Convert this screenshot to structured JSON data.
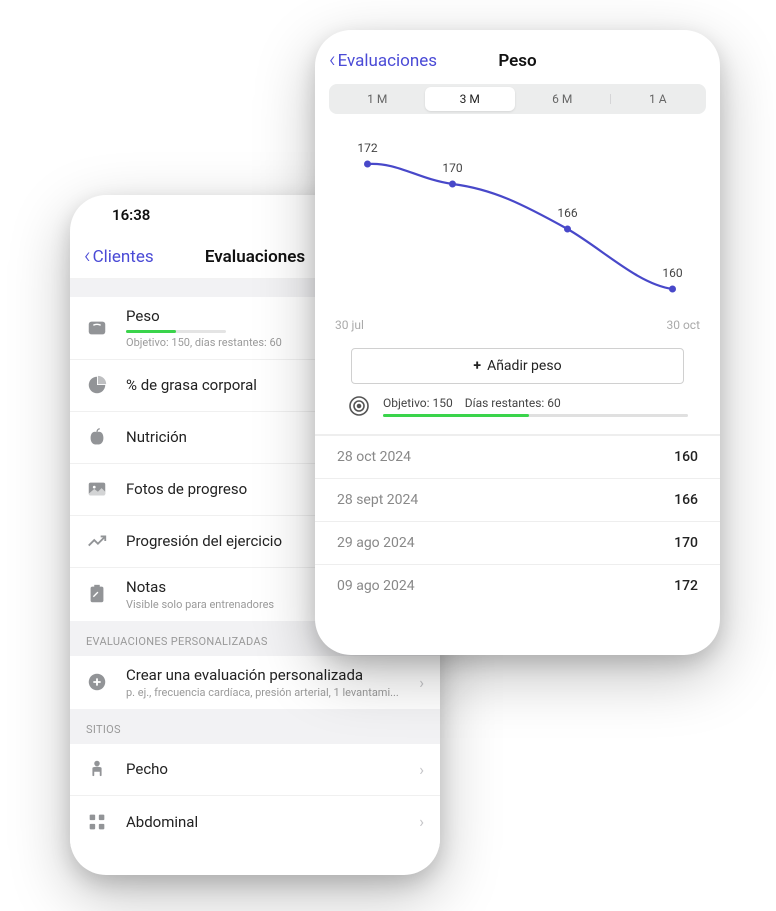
{
  "back_phone": {
    "time": "16:38",
    "back_label": "Clientes",
    "title": "Evaluaciones",
    "assessments": [
      {
        "label": "Peso",
        "subtitle": "Objetivo: 150, días restantes: 60",
        "progress_pct": 50
      },
      {
        "label": "% de grasa corporal"
      },
      {
        "label": "Nutrición"
      },
      {
        "label": "Fotos de progreso"
      },
      {
        "label": "Progresión del ejercicio"
      },
      {
        "label": "Notas",
        "subtitle": "Visible solo para entrenadores"
      }
    ],
    "section_custom": "Evaluaciones personalizadas",
    "custom_row": {
      "title": "Crear una evaluación personalizada",
      "subtitle": "p. ej., frecuencia cardíaca, presión arterial, 1 levantami..."
    },
    "section_sites": "Sitios",
    "sites": [
      {
        "label": "Pecho"
      },
      {
        "label": "Abdominal"
      }
    ]
  },
  "front_phone": {
    "back_label": "Evaluaciones",
    "title": "Peso",
    "timeranges": [
      "1 M",
      "3 M",
      "6 M",
      "1 A"
    ],
    "timerange_active_index": 1,
    "chart_xstart": "30 jul",
    "chart_xend": "30 oct",
    "add_button": "Añadir peso",
    "goal_label": "Objetivo: 150",
    "days_label": "Días restantes: 60",
    "goal_progress_pct": 48,
    "entries": [
      {
        "date": "28 oct 2024",
        "value": "160"
      },
      {
        "date": "28 sept 2024",
        "value": "166"
      },
      {
        "date": "29 ago 2024",
        "value": "170"
      },
      {
        "date": "09 ago 2024",
        "value": "172"
      }
    ]
  },
  "chart_data": {
    "type": "line",
    "x": [
      "09 ago 2024",
      "29 ago 2024",
      "28 sept 2024",
      "28 oct 2024"
    ],
    "values": [
      172,
      170,
      166,
      160
    ],
    "xlabel": "",
    "ylabel": "",
    "xrange": [
      "30 jul",
      "30 oct"
    ],
    "ylim": [
      158,
      175
    ],
    "title": "Peso"
  }
}
